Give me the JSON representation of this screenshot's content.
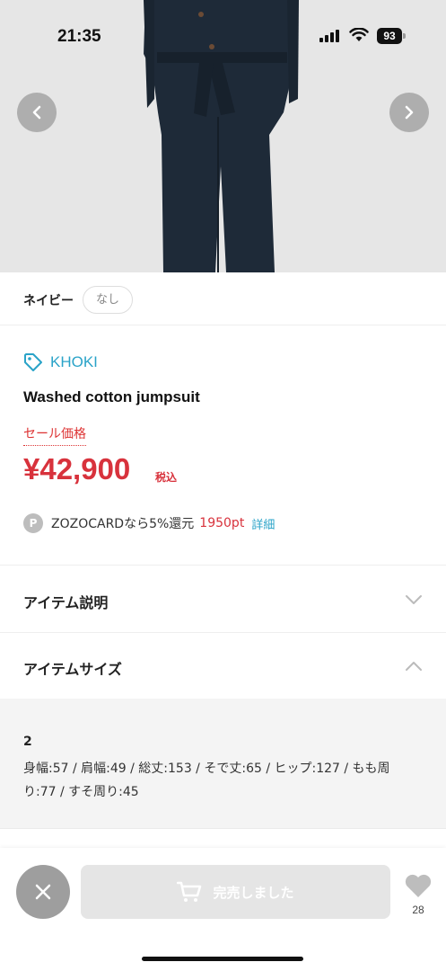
{
  "status_bar": {
    "time": "21:35",
    "battery": "93"
  },
  "product": {
    "color_name": "ネイビー",
    "stock_chip": "なし",
    "brand": "KHOKI",
    "title": "Washed cotton jumpsuit",
    "sale_label": "セール価格",
    "price": "¥42,900",
    "tax_label": "税込"
  },
  "points": {
    "icon_letter": "P",
    "text": "ZOZOCARDなら5%還元",
    "points_value": "1950pt",
    "detail_link": "詳細"
  },
  "sections": {
    "item_description": "アイテム説明",
    "item_size": "アイテムサイズ"
  },
  "size_info": {
    "size": "2",
    "measurements": "身幅:57 / 肩幅:49 / 総丈:153 / そで丈:65 / ヒップ:127 / もも周り:77 / すそ周り:45"
  },
  "bottom_bar": {
    "soldout_label": "完売しました",
    "favorite_count": "28"
  },
  "colors": {
    "accent": "#2aa3c8",
    "sale": "#d8323c",
    "navy": "#1e2a38"
  }
}
